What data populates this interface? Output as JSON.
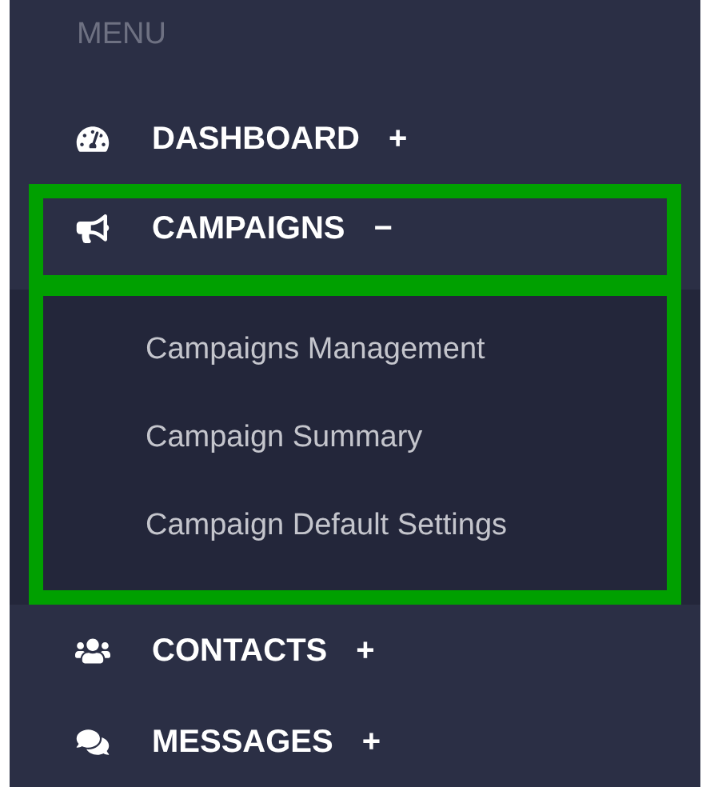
{
  "menu_label": "MENU",
  "items": [
    {
      "kind": "gauge",
      "label": "DASHBOARD",
      "toggle": "+",
      "highlighted": false
    },
    {
      "kind": "megaphone",
      "label": "CAMPAIGNS",
      "toggle": "−",
      "highlighted": true,
      "children": [
        {
          "label": "Campaigns Management"
        },
        {
          "label": "Campaign Summary"
        },
        {
          "label": "Campaign Default Settings"
        }
      ]
    },
    {
      "kind": "group",
      "label": "CONTACTS",
      "toggle": "+",
      "highlighted": false
    },
    {
      "kind": "chat",
      "label": "MESSAGES",
      "toggle": "+",
      "highlighted": false
    }
  ]
}
